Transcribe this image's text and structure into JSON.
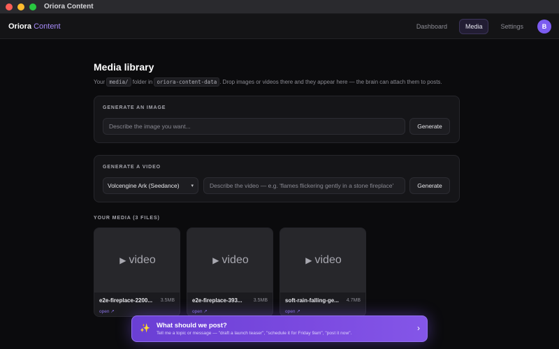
{
  "window": {
    "title": "Oriora Content"
  },
  "nav": {
    "brand_main": "Oriora",
    "brand_accent": "Content",
    "links": [
      {
        "label": "Dashboard",
        "active": false
      },
      {
        "label": "Media",
        "active": true
      },
      {
        "label": "Settings",
        "active": false
      }
    ],
    "avatar_initial": "B"
  },
  "page": {
    "title": "Media library",
    "subtitle_part1": "Your",
    "subtitle_code1": "media/",
    "subtitle_part2": "folder in",
    "subtitle_code2": "oriora-content-data",
    "subtitle_part3": ". Drop images or videos there and they appear here — the brain can attach them to posts."
  },
  "generate_image": {
    "label": "GENERATE AN IMAGE",
    "placeholder": "Describe the image you want...",
    "button": "Generate"
  },
  "generate_video": {
    "label": "GENERATE A VIDEO",
    "model_selected": "Volcengine Ark (Seedance)",
    "placeholder": "Describe the video — e.g. 'flames flickering gently in a stone fireplace'",
    "button": "Generate"
  },
  "media": {
    "label": "YOUR MEDIA (3 FILES)",
    "files": [
      {
        "thumb": "video",
        "name": "e2e-fireplace-2200...",
        "size": "3.5MB",
        "open": "open ↗"
      },
      {
        "thumb": "video",
        "name": "e2e-fireplace-393...",
        "size": "3.5MB",
        "open": "open ↗"
      },
      {
        "thumb": "video",
        "name": "soft-rain-falling-ge...",
        "size": "4.7MB",
        "open": "open ↗"
      }
    ]
  },
  "prompt_bar": {
    "title": "What should we post?",
    "subtitle": "Tell me a topic or message — \"draft a launch teaser\", \"schedule it for Friday 9am\", \"post it now\".",
    "icon": "sparkles-icon"
  },
  "colors": {
    "accent": "#a78bfa",
    "avatar": "#7c5cf0",
    "prompt_bar": "#7b4ae0"
  }
}
